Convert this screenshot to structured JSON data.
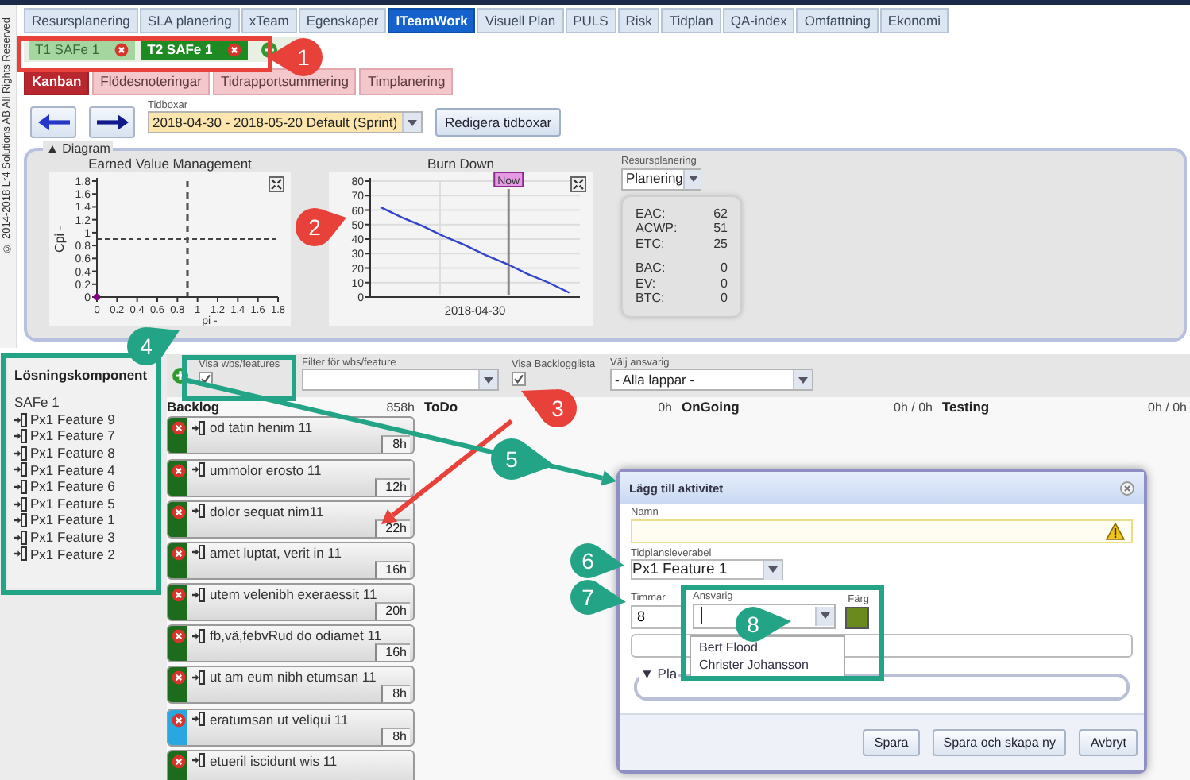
{
  "copyright": "© 2014-2018 Lr4 Solutions AB All Rights Reserved",
  "main_tabs": [
    {
      "label": "Resursplanering",
      "selected": false
    },
    {
      "label": "SLA planering",
      "selected": false
    },
    {
      "label": "xTeam",
      "selected": false
    },
    {
      "label": "Egenskaper",
      "selected": false
    },
    {
      "label": "ITeamWork",
      "selected": true
    },
    {
      "label": "Visuell Plan",
      "selected": false
    },
    {
      "label": "PULS",
      "selected": false
    },
    {
      "label": "Risk",
      "selected": false
    },
    {
      "label": "Tidplan",
      "selected": false
    },
    {
      "label": "QA-index",
      "selected": false
    },
    {
      "label": "Omfattning",
      "selected": false
    },
    {
      "label": "Ekonomi",
      "selected": false
    }
  ],
  "team_tabs": [
    {
      "label": "T1 SAFe 1",
      "selected": false
    },
    {
      "label": "T2 SAFe 1",
      "selected": true
    }
  ],
  "sub_tabs": [
    {
      "label": "Kanban",
      "selected": true
    },
    {
      "label": "Flödesnoteringar",
      "selected": false
    },
    {
      "label": "Tidrapportsummering",
      "selected": false
    },
    {
      "label": "Timplanering",
      "selected": false
    }
  ],
  "toolbar": {
    "timebox_label": "Tidboxar",
    "timebox_value": "2018-04-30 - 2018-05-20 Default (Sprint)",
    "edit_button": "Redigera tidboxar"
  },
  "diagram": {
    "legend": "▲ Diagram",
    "evm": {
      "title": "Earned Value Management",
      "chart_data": {
        "type": "scatter",
        "xlabel": "pi -",
        "ylabel": "Cpi -",
        "x": [
          0
        ],
        "series": [
          {
            "color": "#880088",
            "values": [
              0
            ]
          }
        ],
        "xlim": [
          0,
          1.8
        ],
        "ylim": [
          0,
          1.8
        ],
        "xticks": [
          0,
          0.2,
          0.4,
          0.6,
          0.8,
          1,
          1.2,
          1.4,
          1.6,
          1.8
        ],
        "yticks": [
          0,
          0.2,
          0.4,
          0.6,
          0.8,
          1,
          1.2,
          1.4,
          1.6,
          1.8
        ],
        "ref_lines": [
          {
            "axis": "y",
            "value": 0.9
          },
          {
            "axis": "x",
            "value": 0.9
          }
        ]
      }
    },
    "burndown": {
      "title": "Burn Down",
      "chart_data": {
        "type": "line",
        "grid": true,
        "series": [
          {
            "color": "#3344cc",
            "values": [
              62,
              55,
              49,
              42,
              36,
              29,
              23,
              16,
              10,
              3
            ]
          }
        ],
        "ylim": [
          0,
          80
        ],
        "yticks": [
          0,
          10,
          20,
          30,
          40,
          50,
          60,
          70,
          80
        ],
        "annotations": [
          "Now",
          "2018-04-30"
        ]
      }
    },
    "resource_label": "Resursplanering",
    "resource_value": "Planering",
    "stat_groups": [
      [
        {
          "label": "EAC:",
          "value": "62"
        },
        {
          "label": "ACWP:",
          "value": "51"
        },
        {
          "label": "ETC:",
          "value": "25"
        }
      ],
      [
        {
          "label": "BAC:",
          "value": "0"
        },
        {
          "label": "EV:",
          "value": "0"
        },
        {
          "label": "BTC:",
          "value": "0"
        }
      ]
    ]
  },
  "solution_panel": {
    "title": "Lösningskomponent",
    "items": [
      {
        "label": "SAFe 1",
        "kind": "group"
      },
      {
        "label": "Px1 Feature 9",
        "kind": "feature"
      },
      {
        "label": "Px1 Feature 7",
        "kind": "feature"
      },
      {
        "label": "Px1 Feature 8",
        "kind": "feature"
      },
      {
        "label": "Px1 Feature 4",
        "kind": "feature"
      },
      {
        "label": "Px1 Feature 6",
        "kind": "feature"
      },
      {
        "label": "Px1 Feature 5",
        "kind": "feature"
      },
      {
        "label": "Px1 Feature 1",
        "kind": "feature"
      },
      {
        "label": "Px1 Feature 3",
        "kind": "feature"
      },
      {
        "label": "Px1 Feature 2",
        "kind": "feature"
      }
    ]
  },
  "filters": {
    "show_wbs": {
      "label": "Visa wbs/features",
      "checked": true
    },
    "wbs_filter": {
      "label": "Filter för wbs/feature"
    },
    "show_backlog": {
      "label": "Visa Backlogglista",
      "checked": true
    },
    "responsible": {
      "label": "Välj ansvarig",
      "value": "- Alla lappar -"
    }
  },
  "columns": [
    {
      "title": "Backlog",
      "hours": "858h",
      "cards": [
        {
          "text": "od tatin henim 11",
          "hours": "8h",
          "color": "#1d6b1d"
        },
        {
          "text": "ummolor erosto 11",
          "hours": "12h",
          "color": "#1d6b1d"
        },
        {
          "text": "dolor sequat nim11",
          "hours": "22h",
          "color": "#1d6b1d"
        },
        {
          "text": "amet luptat, verit in 11",
          "hours": "16h",
          "color": "#1d6b1d"
        },
        {
          "text": "utem velenibh exeraessit 11",
          "hours": "20h",
          "color": "#1d6b1d"
        },
        {
          "text": "fb,vä,febvRud do odiamet 11",
          "hours": "16h",
          "color": "#1d6b1d"
        },
        {
          "text": "ut am eum nibh etumsan 11",
          "hours": "8h",
          "color": "#1d6b1d"
        },
        {
          "text": "eratumsan ut veliqui 11",
          "hours": "8h",
          "color": "#2aa7e0"
        },
        {
          "text": "etueril iscidunt wis 11",
          "color": "#1d6b1d"
        }
      ]
    },
    {
      "title": "ToDo",
      "hours": "0h"
    },
    {
      "title": "OnGoing",
      "hours": "0h / 0h"
    },
    {
      "title": "Testing",
      "hours": "0h / 0h"
    }
  ],
  "dialog": {
    "title": "Lägg till aktivitet",
    "name_label": "Namn",
    "name_invalid": true,
    "deliverable_label": "Tidplansleverabel",
    "deliverable_value": "Px1 Feature 1",
    "hours_label": "Timmar",
    "hours_value": "8",
    "responsible_label": "Ansvarig",
    "responsible_options": [
      "Bert Flood",
      "Christer Johansson"
    ],
    "color_label": "Färg",
    "color": "#6b8a1e",
    "planning_legend": "▼ Pla",
    "buttons": [
      "Spara",
      "Spara och skapa ny",
      "Avbryt"
    ]
  },
  "annotations": [
    {
      "label": "1",
      "color": "#e8413a"
    },
    {
      "label": "2",
      "color": "#e8413a"
    },
    {
      "label": "3",
      "color": "#e8413a"
    },
    {
      "label": "4",
      "color": "#23a486"
    },
    {
      "label": "5",
      "color": "#23a486"
    },
    {
      "label": "6",
      "color": "#23a486"
    },
    {
      "label": "7",
      "color": "#23a486"
    },
    {
      "label": "8",
      "color": "#23a486"
    }
  ]
}
